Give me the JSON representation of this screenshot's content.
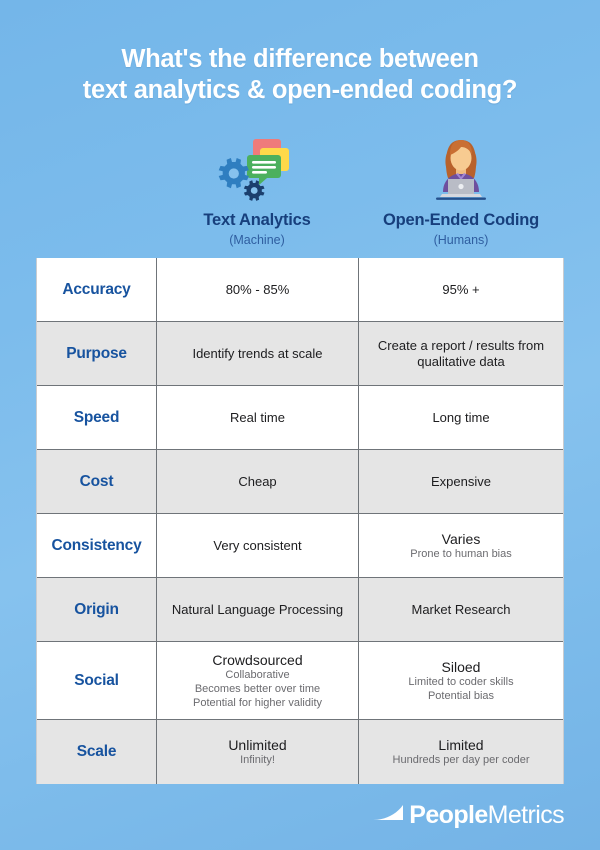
{
  "title": {
    "line1": "What's the difference between",
    "line2": "text analytics & open-ended coding?"
  },
  "columns": [
    {
      "icon": "speech-bubbles-gears-icon",
      "title": "Text Analytics",
      "subtitle": "(Machine)"
    },
    {
      "icon": "person-at-laptop-icon",
      "title": "Open-Ended Coding",
      "subtitle": "(Humans)"
    }
  ],
  "table": {
    "rows": [
      {
        "label": "Accuracy",
        "col1": {
          "main": "80% - 85%",
          "subs": []
        },
        "col2": {
          "main": "95% +",
          "subs": []
        }
      },
      {
        "label": "Purpose",
        "col1": {
          "main": "Identify trends at scale",
          "subs": []
        },
        "col2": {
          "main": "Create a report / results from qualitative data",
          "subs": []
        }
      },
      {
        "label": "Speed",
        "col1": {
          "main": "Real time",
          "subs": []
        },
        "col2": {
          "main": "Long time",
          "subs": []
        }
      },
      {
        "label": "Cost",
        "col1": {
          "main": "Cheap",
          "subs": []
        },
        "col2": {
          "main": "Expensive",
          "subs": []
        }
      },
      {
        "label": "Consistency",
        "col1": {
          "main": "Very consistent",
          "subs": []
        },
        "col2": {
          "main": "Varies",
          "subs": [
            "Prone to human bias"
          ]
        }
      },
      {
        "label": "Origin",
        "col1": {
          "main": "Natural Language Processing",
          "subs": []
        },
        "col2": {
          "main": "Market Research",
          "subs": []
        }
      },
      {
        "label": "Social",
        "col1": {
          "main": "Crowdsourced",
          "subs": [
            "Collaborative",
            "Becomes better over time",
            "Potential for higher validity"
          ]
        },
        "col2": {
          "main": "Siloed",
          "subs": [
            "Limited to coder skills",
            "Potential bias"
          ]
        }
      },
      {
        "label": "Scale",
        "col1": {
          "main": "Unlimited",
          "subs": [
            "Infinity!"
          ]
        },
        "col2": {
          "main": "Limited",
          "subs": [
            "Hundreds per day per coder"
          ]
        }
      }
    ]
  },
  "logo": {
    "bold": "People",
    "light": "Metrics"
  },
  "colors": {
    "background_blue": "#7cbcec",
    "heading_white": "#ffffff",
    "column_title_navy": "#173f7c",
    "row_label_blue": "#17539f",
    "body_text": "#1d1d1f",
    "sub_text_gray": "#6b6b6f",
    "row_white": "#ffffff",
    "row_gray": "#e5e5e5",
    "border_gray": "#6f7479"
  }
}
